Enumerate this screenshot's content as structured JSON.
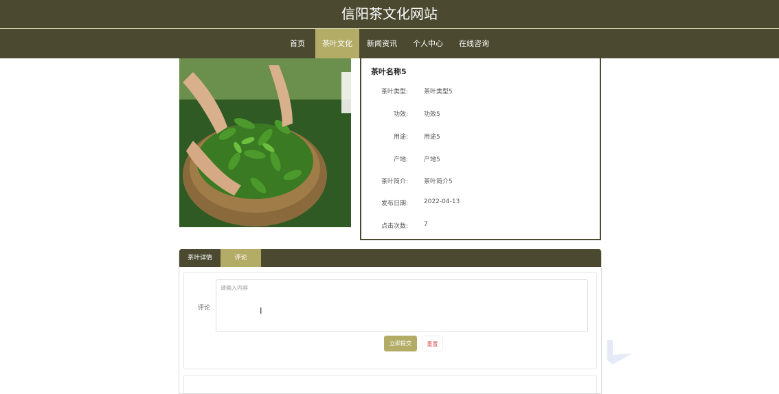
{
  "site": {
    "title": "信阳茶文化网站"
  },
  "nav": {
    "items": [
      {
        "label": "首页",
        "active": false
      },
      {
        "label": "茶叶文化",
        "active": true
      },
      {
        "label": "新闻资讯",
        "active": false
      },
      {
        "label": "个人中心",
        "active": false
      },
      {
        "label": "在线咨询",
        "active": false
      }
    ]
  },
  "product": {
    "name": "茶叶名称5",
    "fields": [
      {
        "label": "茶叶类型:",
        "value": "茶叶类型5"
      },
      {
        "label": "功效:",
        "value": "功效5"
      },
      {
        "label": "用途:",
        "value": "用途5"
      },
      {
        "label": "产地:",
        "value": "产地5"
      },
      {
        "label": "茶叶简介:",
        "value": "茶叶简介5"
      },
      {
        "label": "发布日期:",
        "value": "2022-04-13"
      },
      {
        "label": "点击次数:",
        "value": "7"
      }
    ]
  },
  "tabs": [
    {
      "label": "茶叶详情",
      "active": false
    },
    {
      "label": "评论",
      "active": true
    }
  ],
  "comment_form": {
    "label": "评论",
    "placeholder": "请输入内容",
    "submit_label": "立即提交",
    "reset_label": "重置"
  },
  "colors": {
    "header_bg": "#4b4a31",
    "accent": "#b3ac67",
    "reset_text": "#d9534f"
  }
}
